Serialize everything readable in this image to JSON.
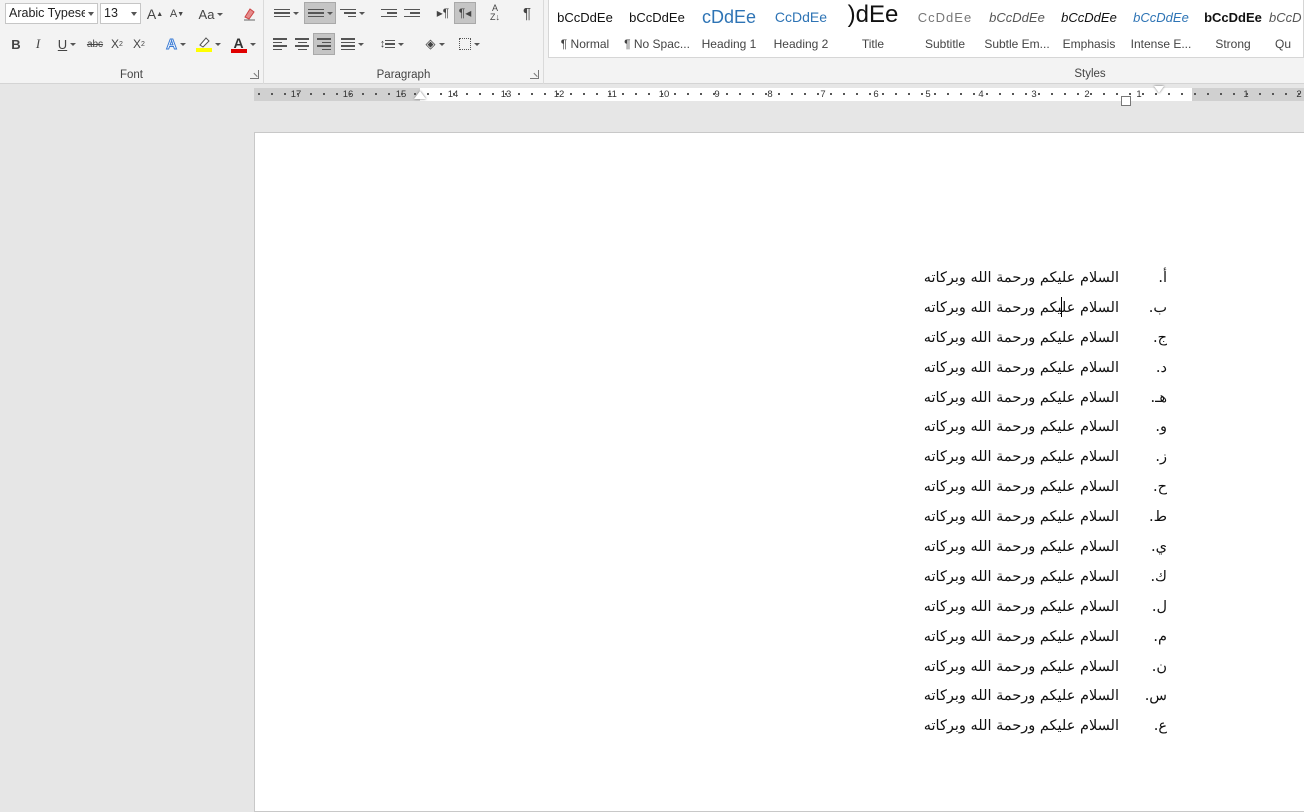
{
  "ribbon": {
    "font": {
      "label": "Font",
      "font_name": "Arabic Typesetting",
      "font_size": "13",
      "grow_label": "A",
      "shrink_label": "A",
      "case_label": "Aa",
      "bold_label": "B",
      "italic_label": "I",
      "underline_label": "U",
      "strike_label": "abc",
      "subscript_label": "X",
      "subscript_sub": "2",
      "superscript_label": "X",
      "superscript_sup": "2",
      "effects_label": "A",
      "font_color_label": "A",
      "highlight_color": "#ffff00",
      "font_color": "#e00000"
    },
    "paragraph": {
      "label": "Paragraph",
      "show_marks_label": "¶"
    },
    "styles": {
      "label": "Styles",
      "items": [
        {
          "sample": "bCcDdEe",
          "name": "¶ Normal"
        },
        {
          "sample": "bCcDdEe",
          "name": "¶ No Spac..."
        },
        {
          "sample": "cDdEe",
          "name": "Heading 1"
        },
        {
          "sample": "CcDdEe",
          "name": "Heading 2"
        },
        {
          "sample": ")dEe",
          "name": "Title"
        },
        {
          "sample": "CcDdEe",
          "name": "Subtitle"
        },
        {
          "sample": "bCcDdEe",
          "name": "Subtle Em..."
        },
        {
          "sample": "bCcDdEe",
          "name": "Emphasis"
        },
        {
          "sample": "bCcDdEe",
          "name": "Intense E..."
        },
        {
          "sample": "bCcDdEe",
          "name": "Strong"
        },
        {
          "sample": "bCcD",
          "name": "Qu"
        }
      ]
    }
  },
  "ruler": {
    "numbers": [
      "17",
      "16",
      "15",
      "14",
      "13",
      "12",
      "11",
      "10",
      "9",
      "8",
      "7",
      "6",
      "5",
      "4",
      "3",
      "2",
      "1",
      "1",
      "2"
    ]
  },
  "document": {
    "items": [
      {
        "num": "أ.",
        "text": "السلام عليكم ورحمة الله وبركاته"
      },
      {
        "num": "ب.",
        "text": "السلام عليكم ورحمة الله وبركاته"
      },
      {
        "num": "ج.",
        "text": "السلام عليكم ورحمة الله وبركاته"
      },
      {
        "num": "د.",
        "text": "السلام عليكم ورحمة الله وبركاته"
      },
      {
        "num": "هـ.",
        "text": "السلام عليكم ورحمة الله وبركاته"
      },
      {
        "num": "و.",
        "text": "السلام عليكم ورحمة الله وبركاته"
      },
      {
        "num": "ز.",
        "text": "السلام عليكم ورحمة الله وبركاته"
      },
      {
        "num": "ح.",
        "text": "السلام عليكم ورحمة الله وبركاته"
      },
      {
        "num": "ط.",
        "text": "السلام عليكم ورحمة الله وبركاته"
      },
      {
        "num": "ي.",
        "text": "السلام عليكم ورحمة الله وبركاته"
      },
      {
        "num": "ك.",
        "text": "السلام عليكم ورحمة الله وبركاته"
      },
      {
        "num": "ل.",
        "text": "السلام عليكم ورحمة الله وبركاته"
      },
      {
        "num": "م.",
        "text": "السلام عليكم ورحمة الله وبركاته"
      },
      {
        "num": "ن.",
        "text": "السلام عليكم ورحمة الله وبركاته"
      },
      {
        "num": "س.",
        "text": "السلام عليكم ورحمة الله وبركاته"
      },
      {
        "num": "ع.",
        "text": "السلام عليكم ورحمة الله وبركاته"
      }
    ]
  }
}
